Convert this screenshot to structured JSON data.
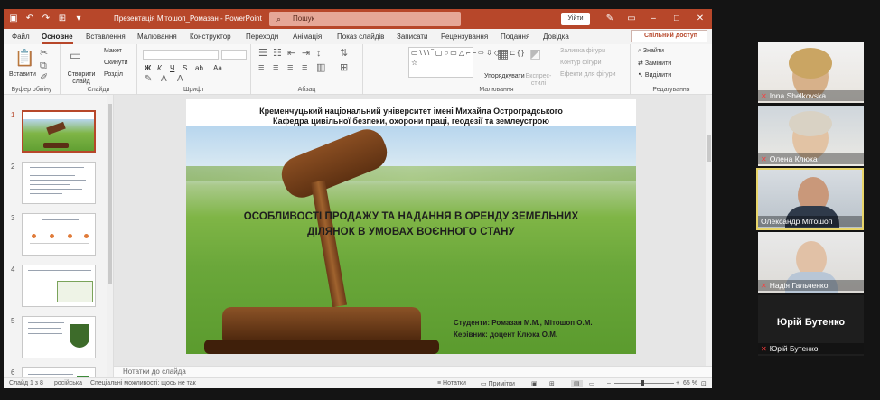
{
  "window": {
    "title": "Презентація Мітошоп_Ромазан  -  PowerPoint",
    "search_placeholder": "Пошук",
    "signin": "Уійти"
  },
  "menu": {
    "tabs": [
      "Файл",
      "Основне",
      "Вставлення",
      "Малювання",
      "Конструктор",
      "Переходи",
      "Анімація",
      "Показ слайдів",
      "Записати",
      "Рецензування",
      "Подання",
      "Довідка"
    ],
    "active": "Основне",
    "share": "Спільний доступ"
  },
  "ribbon": {
    "clipboard": {
      "label": "Буфер обміну",
      "paste": "Вставити"
    },
    "slides": {
      "label": "Слайди",
      "new_slide": "Створити слайд",
      "layout": "Макет",
      "reset": "Скинути",
      "section": "Розділ"
    },
    "font": {
      "label": "Шрифт"
    },
    "paragraph": {
      "label": "Абзац"
    },
    "drawing": {
      "label": "Малювання",
      "arrange": "Упорядкувати",
      "quick_styles": "Експрес-стилі",
      "fill": "Заливка фігури",
      "outline": "Контур фігури",
      "effects": "Ефекти для фігури"
    },
    "editing": {
      "label": "Редагування",
      "find": "Знайти",
      "replace": "Замінити",
      "select": "Виділити"
    }
  },
  "thumbnails": {
    "numbers": [
      "1",
      "2",
      "3",
      "4",
      "5",
      "6"
    ]
  },
  "slide": {
    "header_line1": "Кременчуцький національний університет імені Михайла Остроградського",
    "header_line2": "Кафедра цивільної безпеки, охорони праці, геодезії та землеустрою",
    "title_line1": "ОСОБЛИВОСТІ ПРОДАЖУ ТА НАДАННЯ В ОРЕНДУ ЗЕМЕЛЬНИХ",
    "title_line2": "ДІЛЯНОК В УМОВАХ ВОЄННОГО СТАНУ",
    "students": "Студенти: Ромазан М.М., Мітошоп О.М.",
    "supervisor": "Керівник:   доцент Клюка О.М."
  },
  "notes": "Нотатки до слайда",
  "status": {
    "slide": "Слайд 1 з 8",
    "language": "російська",
    "accessibility": "Спеціальні можливості: щось не так",
    "notes_btn": "Нотатки",
    "comments_btn": "Примітки",
    "zoom": "65 %"
  },
  "participants": [
    {
      "name": "Inna Shelkovska"
    },
    {
      "name": "Олена Клюка"
    },
    {
      "name": "Олександр Мітошоп"
    },
    {
      "name": "Надія Гальченко"
    },
    {
      "name": "Юрій Бутенко",
      "center_name": "Юрій Бутенко"
    }
  ],
  "colors": {
    "accent": "#b7472a",
    "active_speaker": "#e8d56a"
  }
}
